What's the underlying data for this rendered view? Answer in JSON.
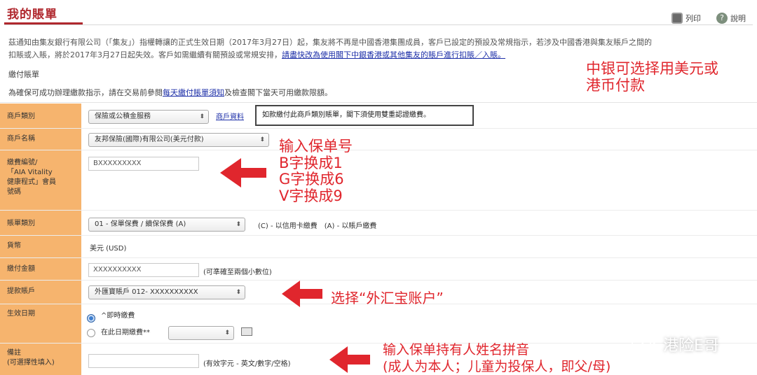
{
  "header": {
    "title": "我的賬單",
    "print_label": "列印",
    "help_label": "說明"
  },
  "notice": {
    "line1": "茲通知由集友銀行有限公司（「集友」）指權轉讓的正式生效日期（2017年3月27日）起，集友將不再是中國香港集團成員，客戶已設定的預設及常規指示，若涉及中國香港與集友賬戶之間的",
    "line2_prefix": "扣賬或入賬，將於2017年3月27日起失效。客戶如需繼續有關預設或常規安排，",
    "line2_link": "請盡快改為使用閣下中銀香港或其他集友的賬戶進行扣賬／入賬。"
  },
  "section": {
    "title": "繳付賬單",
    "instruction_prefix": "為確保可成功辦理繳款指示，請在交易前參閱",
    "instruction_link": "每天繳付賬單須知",
    "instruction_suffix": "及檢查閣下當天可用繳款限額。"
  },
  "form": {
    "merchant_type": {
      "label": "商戶類別",
      "value": "保險或公積金服務",
      "link": "商戶資料",
      "note": "如款繳付此商戶類別賬單，閣下須使用雙重認證繳費。"
    },
    "merchant_name": {
      "label": "商戶名稱",
      "value": "友邦保險(國際)有限公司(美元付款)"
    },
    "account_no": {
      "label": "繳費編號/\n「AIA Vitality\n健康程式」會員\n號碼",
      "value": "BXXXXXXXXX"
    },
    "bill_type": {
      "label": "賬單類別",
      "value": "01 - 保單保費 / 續保保費 (A)",
      "hint": "(C) - 以信用卡繳費　(A) - 以賬戶繳費"
    },
    "currency": {
      "label": "貨幣",
      "value": "美元 (USD)"
    },
    "amount": {
      "label": "繳付金額",
      "value": "XXXXXXXXXX",
      "hint": "(可準確至兩個小數位)"
    },
    "debit_account": {
      "label": "提款賬戶",
      "value": "外匯寶賬戶 012- XXXXXXXXXX"
    },
    "effective_date": {
      "label": "生效日期",
      "option_now": "^即時繳費",
      "option_later": "在此日期繳費**"
    },
    "remark": {
      "label": "備註\n(可選擇性填入)",
      "hint": "(有效字元 - 英文/數字/空格)"
    }
  },
  "annotations": {
    "currency_note": "中银可选择用美元或\n港币付款",
    "policy_no": "输入保单号\nB字换成1\nG字换成6\nV字换成9",
    "choose_account": "选择“外汇宝账户”",
    "name_pinyin": "输入保单持有人姓名拼音\n(成人为本人；儿童为投保人，即父/母)"
  },
  "watermark": {
    "text": "港险E哥"
  },
  "colors": {
    "title_red": "#b0282e",
    "label_col": "#f6b46e",
    "annotation_red": "#e0262d",
    "link_blue": "#1d2fa8"
  }
}
